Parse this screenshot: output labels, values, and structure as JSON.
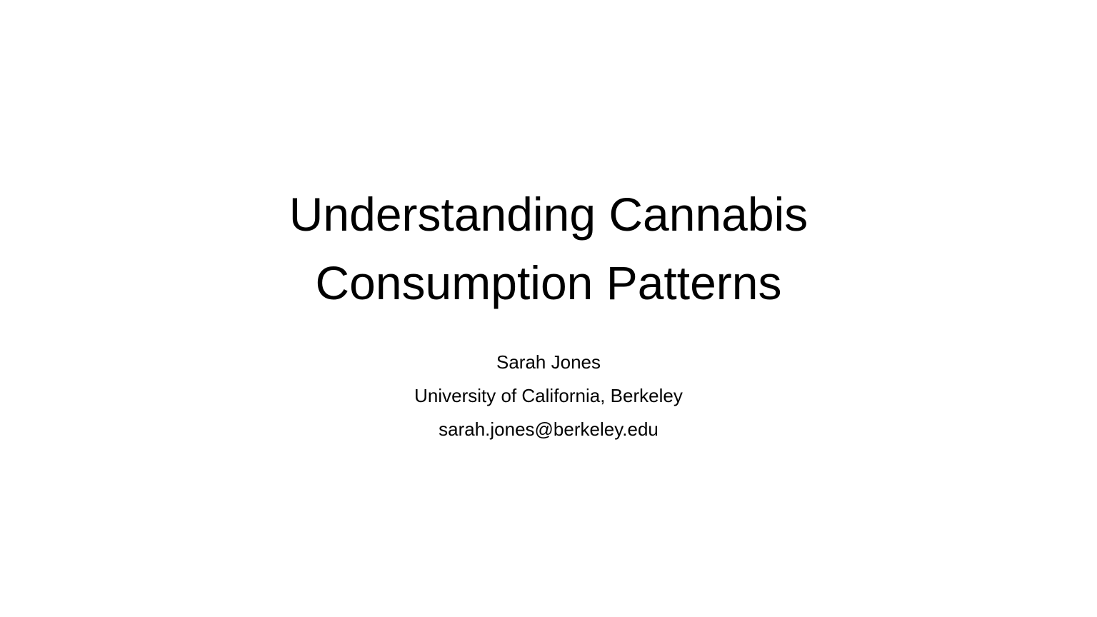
{
  "slide": {
    "title_lines": [
      "Understanding Cannabis",
      "Consumption Patterns"
    ],
    "subtitle_lines": [
      "Sarah Jones",
      "University of California, Berkeley",
      "sarah.jones@berkeley.edu"
    ]
  },
  "colors": {
    "background": "#ffffff",
    "text": "#000000"
  }
}
